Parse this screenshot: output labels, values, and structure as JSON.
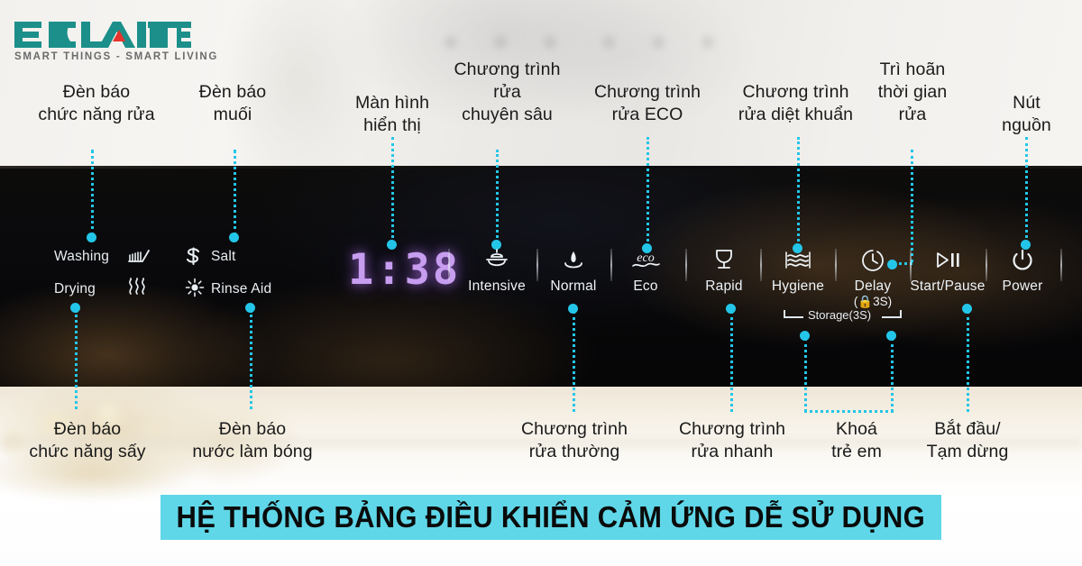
{
  "brand": {
    "name": "ECALITE",
    "tagline": "SMART THINGS - SMART LIVING",
    "primary_color": "#1c8f8a",
    "accent_color": "#e8322c"
  },
  "theme": {
    "connector_color": "#23c6e8",
    "banner_color": "#5fd7e8",
    "display_color": "#c79df0",
    "panel_text_color": "#eef3f7"
  },
  "callouts_top": [
    {
      "id": "washing-indicator",
      "text": "Đèn báo\nchức năng rửa"
    },
    {
      "id": "salt-indicator",
      "text": "Đèn báo\nmuối"
    },
    {
      "id": "display-screen",
      "text": "Màn hình\nhiển thị"
    },
    {
      "id": "intensive-program",
      "text": "Chương trình\nrửa\nchuyên sâu"
    },
    {
      "id": "eco-program",
      "text": "Chương trình\nrửa ECO"
    },
    {
      "id": "hygiene-program",
      "text": "Chương trình\nrửa diệt khuẩn"
    },
    {
      "id": "delay-program",
      "text": "Trì hoãn\nthời gian\nrửa"
    },
    {
      "id": "power-button",
      "text": "Nút\nnguồn"
    }
  ],
  "callouts_bottom": [
    {
      "id": "drying-indicator",
      "text": "Đèn báo\nchức năng sấy"
    },
    {
      "id": "rinse-aid-indicator",
      "text": "Đèn báo\nnước làm bóng"
    },
    {
      "id": "normal-program",
      "text": "Chương trình\nrửa thường"
    },
    {
      "id": "rapid-program",
      "text": "Chương trình\nrửa nhanh"
    },
    {
      "id": "child-lock",
      "text": "Khoá\ntrẻ em"
    },
    {
      "id": "start-pause",
      "text": "Bắt đầu/\nTạm dừng"
    }
  ],
  "panel": {
    "indicators": [
      {
        "id": "washing",
        "label": "Washing",
        "icon": "brush-icon"
      },
      {
        "id": "drying",
        "label": "Drying",
        "icon": "heat-waves-icon"
      },
      {
        "id": "salt",
        "label": "Salt",
        "icon": "salt-icon"
      },
      {
        "id": "rinse-aid",
        "label": "Rinse Aid",
        "icon": "rinse-aid-sparkle-icon"
      }
    ],
    "display_value": "1:38",
    "buttons": [
      {
        "id": "intensive",
        "label": "Intensive",
        "icon": "pot-with-lid-icon",
        "sub": ""
      },
      {
        "id": "normal",
        "label": "Normal",
        "icon": "water-drop-icon",
        "sub": ""
      },
      {
        "id": "eco",
        "label": "Eco",
        "icon": "eco-leaf-icon",
        "sub": ""
      },
      {
        "id": "rapid",
        "label": "Rapid",
        "icon": "wine-glass-icon",
        "sub": ""
      },
      {
        "id": "hygiene",
        "label": "Hygiene",
        "icon": "hygiene-waves-icon",
        "sub": ""
      },
      {
        "id": "delay",
        "label": "Delay",
        "icon": "clock-icon",
        "sub": "(🔒3S)"
      },
      {
        "id": "start-pause",
        "label": "Start/Pause",
        "icon": "play-pause-icon",
        "sub": ""
      },
      {
        "id": "power",
        "label": "Power",
        "icon": "power-icon",
        "sub": ""
      }
    ],
    "storage_note": "Storage(3S)"
  },
  "banner": {
    "text": "HỆ THỐNG BẢNG ĐIỀU KHIỂN CẢM ỨNG DỄ SỬ DỤNG"
  }
}
